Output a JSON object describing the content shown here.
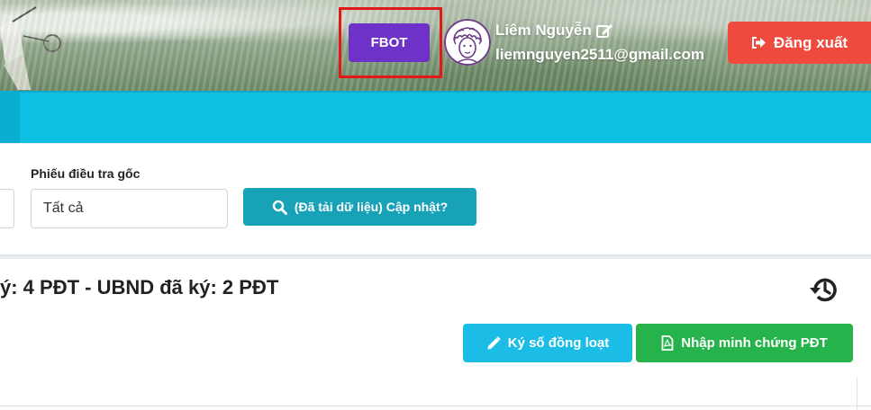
{
  "header": {
    "fbot_label": "FBOT",
    "user": {
      "name": "Liêm Nguyễn",
      "email": "liemnguyen2511@gmail.com"
    },
    "logout_label": "Đăng xuất"
  },
  "filter": {
    "label": "Phiếu điều tra gốc",
    "value": "Tất cả",
    "update_label": "(Đã tải dữ liệu) Cập nhật?"
  },
  "main": {
    "summary": "ý: 4 PĐT - UBND đã ký: 2 PĐT",
    "sign_all_label": "Ký số đồng loạt",
    "import_label": "Nhập minh chứng PĐT"
  },
  "colors": {
    "fbot": "#6f32c9",
    "logout": "#f0493e",
    "nav_bar": "#0fc0e4",
    "update": "#17a2b8",
    "sign": "#1bbde6",
    "import": "#27b34b",
    "highlight": "#e1191b"
  }
}
